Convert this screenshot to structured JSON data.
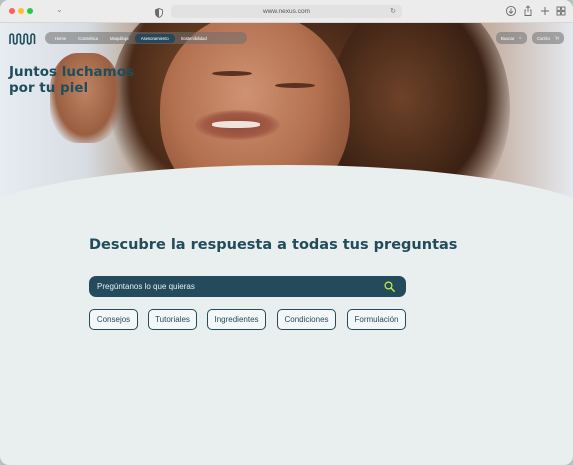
{
  "browser": {
    "url": "www.nexus.com",
    "reload_icon": "reload-icon",
    "toolbar_icons": [
      "download-icon",
      "share-icon",
      "new-tab-icon",
      "tab-overview-icon"
    ]
  },
  "site": {
    "logo": "nexus-wave-logo",
    "nav": [
      {
        "label": "Home",
        "active": false
      },
      {
        "label": "Cosmética",
        "active": false
      },
      {
        "label": "Maquillaje",
        "active": false
      },
      {
        "label": "Asesoramiento",
        "active": true
      },
      {
        "label": "Sostenibilidad",
        "active": false
      }
    ],
    "search_label": "Buscar",
    "cart_label": "Carrito"
  },
  "hero": {
    "title_line1": "Juntos luchamos",
    "title_line2": "por tu piel"
  },
  "main": {
    "heading": "Descubre la respuesta a todas tus preguntas",
    "search_placeholder": "Pregúntanos lo que quieras",
    "chips": [
      "Consejos",
      "Tutoriales",
      "Ingredientes",
      "Condiciones",
      "Formulación"
    ]
  },
  "colors": {
    "brand_dark": "#244b5c",
    "accent": "#c8f04a",
    "background": "#e9eeee"
  }
}
